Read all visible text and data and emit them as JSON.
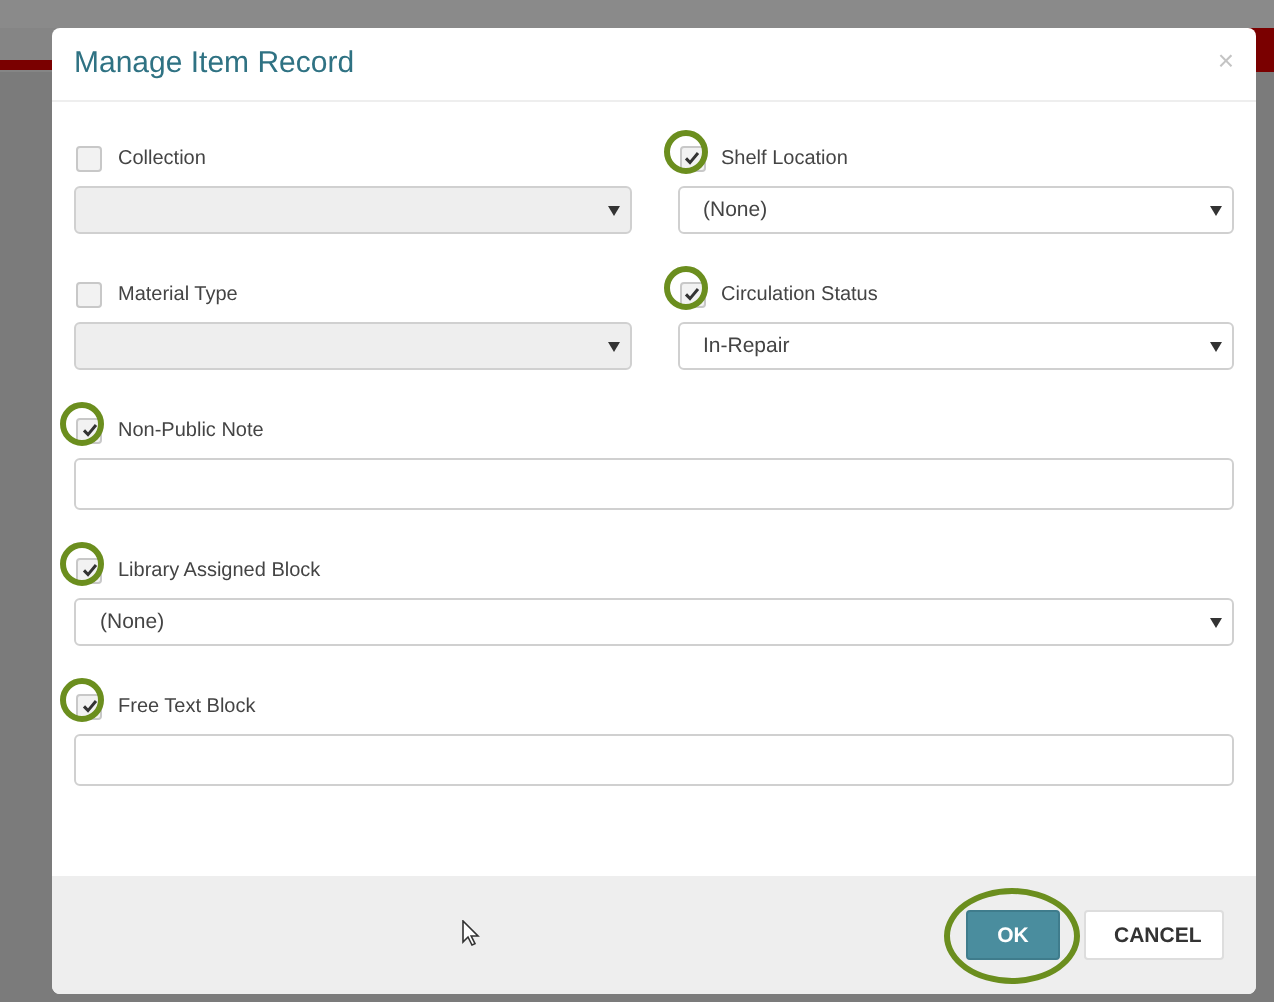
{
  "dialog": {
    "title": "Manage Item Record",
    "close": "×"
  },
  "rows": [
    [
      {
        "label": "Collection",
        "checked": false,
        "highlighted": false,
        "kind": "select",
        "disabled": true
      },
      {
        "label": "Shelf Location",
        "checked": true,
        "highlighted": true,
        "kind": "select",
        "disabled": false,
        "value": "(None)"
      }
    ],
    [
      {
        "label": "Material Type",
        "checked": false,
        "highlighted": false,
        "kind": "select",
        "disabled": true
      },
      {
        "label": "Circulation Status",
        "checked": true,
        "highlighted": true,
        "kind": "select",
        "disabled": false,
        "value": "In-Repair"
      }
    ],
    [
      {
        "label": "Non-Public Note",
        "checked": true,
        "highlighted": true,
        "kind": "text"
      }
    ],
    [
      {
        "label": "Library Assigned Block",
        "checked": true,
        "highlighted": true,
        "kind": "select",
        "disabled": false,
        "value": "(None)"
      }
    ],
    [
      {
        "label": "Free Text Block",
        "checked": true,
        "highlighted": true,
        "kind": "text"
      }
    ]
  ],
  "buttons": [
    {
      "label": "OK",
      "kind": "primary",
      "highlighted": true
    },
    {
      "label": "CANCEL",
      "kind": "default",
      "highlighted": false
    }
  ]
}
